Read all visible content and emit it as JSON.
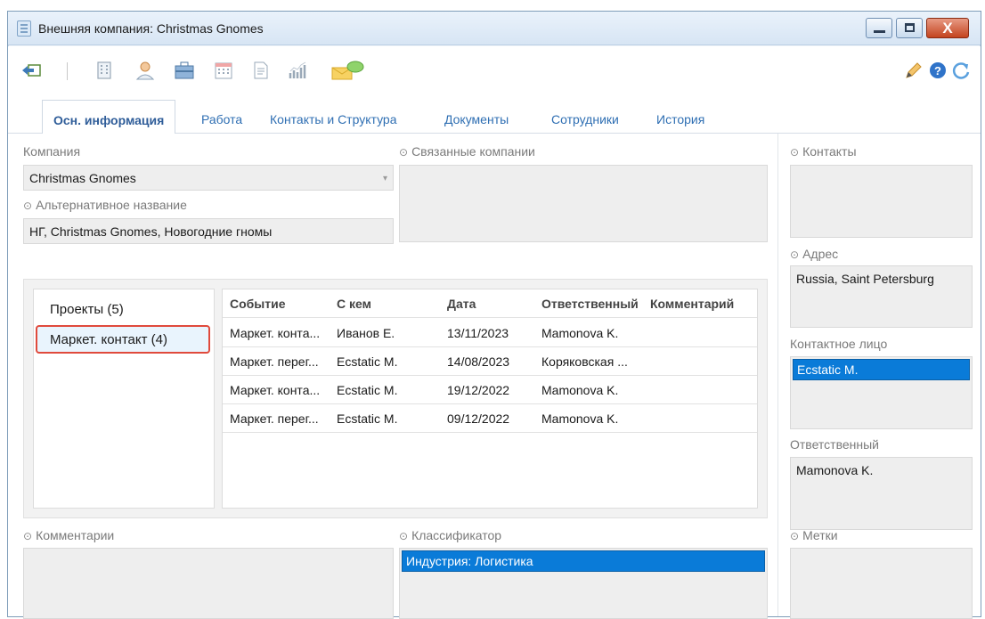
{
  "window": {
    "title": "Внешняя компания: Christmas Gnomes",
    "close_glyph": "X"
  },
  "toolbar": {
    "icons": [
      "back-arrow-icon",
      "building-icon",
      "person-icon",
      "briefcase-icon",
      "calendar-icon",
      "document-icon",
      "chart-icon",
      "message-icon",
      "pencil-icon",
      "help-icon",
      "refresh-icon"
    ],
    "help_glyph": "?"
  },
  "tabs": [
    {
      "label": "Осн. информация",
      "active": true
    },
    {
      "label": "Работа"
    },
    {
      "label": "Контакты и Структура"
    },
    {
      "label": "Документы"
    },
    {
      "label": "Сотрудники"
    },
    {
      "label": "История"
    }
  ],
  "form": {
    "company_label": "Компания",
    "company_value": "Christmas Gnomes",
    "alt_name_label": "Альтернативное название",
    "alt_name_value": "НГ, Christmas Gnomes, Новогодние гномы",
    "related_label": "Связанные компании",
    "comments_label": "Комментарии",
    "classifier_label": "Классификатор",
    "classifier_items": [
      "Индустрия: Логистика"
    ],
    "toggle_glyph": "⊙"
  },
  "right": {
    "contacts_label": "Контакты",
    "address_label": "Адрес",
    "address_value": "Russia, Saint Petersburg",
    "contact_person_label": "Контактное лицо",
    "contact_person_value": "Ecstatic M.",
    "responsible_label": "Ответственный",
    "responsible_value": "Mamonova K.",
    "tags_label": "Метки"
  },
  "left_list": {
    "items": [
      "Проекты (5)",
      "Маркет. контакт (4)"
    ],
    "selected_index": 1
  },
  "grid": {
    "columns": [
      "Событие",
      "С кем",
      "Дата",
      "Ответственный",
      "Комментарий"
    ],
    "rows": [
      [
        "Маркет. конта...",
        "Иванов Е.",
        "13/11/2023",
        "Mamonova K.",
        ""
      ],
      [
        "Маркет. перег...",
        "Ecstatic M.",
        "14/08/2023",
        "Коряковская ...",
        ""
      ],
      [
        "Маркет. конта...",
        "Ecstatic M.",
        "19/12/2022",
        "Mamonova K.",
        ""
      ],
      [
        "Маркет. перег...",
        "Ecstatic M.",
        "09/12/2022",
        "Mamonova K.",
        ""
      ]
    ]
  },
  "colors": {
    "selection": "#0a7bd8",
    "tab_text": "#2f6fb3",
    "highlight_border": "#e04a3c"
  }
}
